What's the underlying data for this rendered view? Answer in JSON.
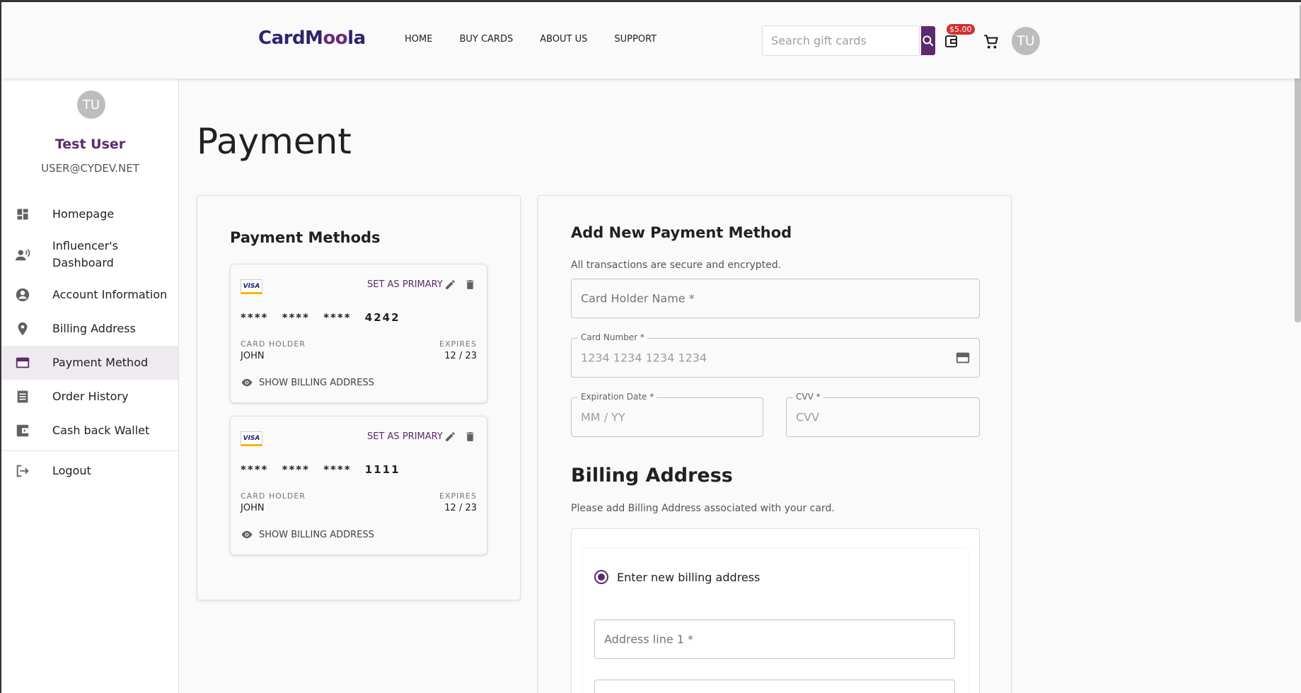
{
  "header": {
    "logo_text_a": "CardM",
    "logo_text_b": "oo",
    "logo_text_c": "la",
    "nav": [
      "HOME",
      "BUY CARDS",
      "ABOUT US",
      "SUPPORT"
    ],
    "search_placeholder": "Search gift cards",
    "wallet_badge": "$5.00",
    "avatar_initials": "TU"
  },
  "sidebar": {
    "avatar_initials": "TU",
    "name": "Test User",
    "email": "USER@CYDEV.NET",
    "items": [
      {
        "label": "Homepage",
        "icon": "dashboard-icon"
      },
      {
        "label": "Influencer's Dashboard",
        "icon": "record-voice-icon"
      },
      {
        "label": "Account Information",
        "icon": "account-circle-icon"
      },
      {
        "label": "Billing Address",
        "icon": "location-pin-icon"
      },
      {
        "label": "Payment Method",
        "icon": "credit-card-icon",
        "active": true
      },
      {
        "label": "Order History",
        "icon": "receipt-icon"
      },
      {
        "label": "Cash back Wallet",
        "icon": "wallet-icon"
      }
    ],
    "logout": "Logout"
  },
  "main": {
    "title": "Payment",
    "payment_methods": {
      "title": "Payment Methods",
      "cards": [
        {
          "brand": "VISA",
          "set_primary": "SET AS PRIMARY",
          "number": "**** **** **** 4242",
          "holder_label": "CARD HOLDER",
          "holder": "JOHN",
          "expires_label": "EXPIRES",
          "expires": "12 / 23",
          "show_billing": "SHOW BILLING ADDRESS"
        },
        {
          "brand": "VISA",
          "set_primary": "SET AS PRIMARY",
          "number": "**** **** **** 1111",
          "holder_label": "CARD HOLDER",
          "holder": "JOHN",
          "expires_label": "EXPIRES",
          "expires": "12 / 23",
          "show_billing": "SHOW BILLING ADDRESS"
        }
      ]
    },
    "add_form": {
      "title": "Add New Payment Method",
      "secure_text": "All transactions are secure and encrypted.",
      "holder_placeholder": "Card Holder Name *",
      "number_label": "Card Number *",
      "number_placeholder": "1234 1234 1234 1234",
      "exp_label": "Expiration Date *",
      "exp_placeholder": "MM / YY",
      "cvv_label": "CVV *",
      "cvv_placeholder": "CVV",
      "billing_title": "Billing Address",
      "billing_sub": "Please add Billing Address associated with your card.",
      "radio_label": "Enter new billing address",
      "address1_placeholder": "Address line 1 *"
    }
  },
  "colors": {
    "brand": "#5c2a6e",
    "badge": "#d32f2f"
  }
}
